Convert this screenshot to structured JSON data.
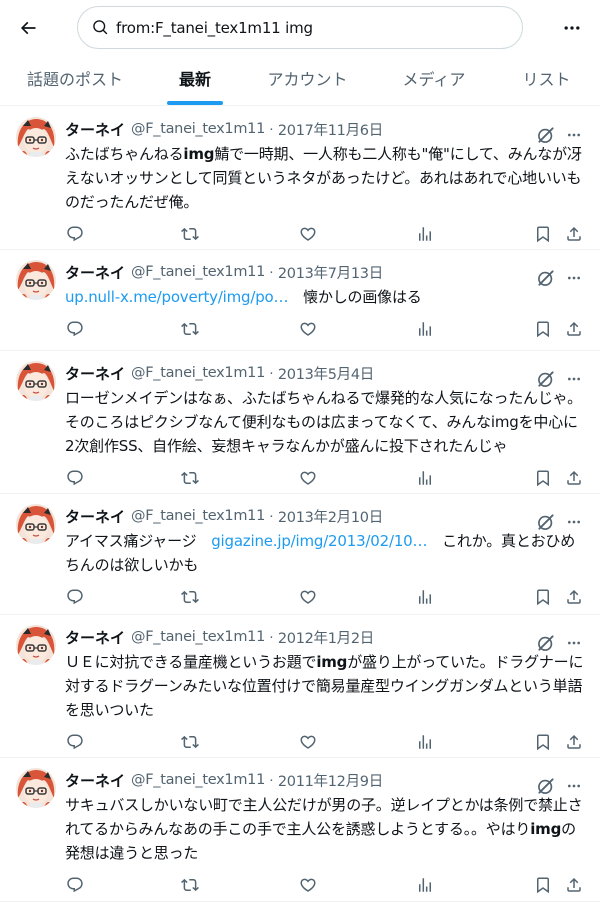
{
  "search": {
    "query": "from:F_tanei_tex1m11 img"
  },
  "tabs": [
    {
      "label": "話題のポスト",
      "active": false
    },
    {
      "label": "最新",
      "active": true
    },
    {
      "label": "アカウント",
      "active": false
    },
    {
      "label": "メディア",
      "active": false
    },
    {
      "label": "リスト",
      "active": false
    }
  ],
  "author": {
    "name": "ターネイ",
    "handle": "@F_tanei_tex1m11"
  },
  "tweets": [
    {
      "date": "2017年11月6日",
      "text_parts": [
        {
          "t": "ふたばちゃんねる"
        },
        {
          "t": "img",
          "bold": true
        },
        {
          "t": "鯖で一時期、一人称も二人称も\"俺\"にして、みんなが冴えないオッサンとして同質というネタがあったけど。あれはあれで心地いいものだったんだぜ俺。"
        }
      ]
    },
    {
      "date": "2013年7月13日",
      "text_parts": [
        {
          "t": "up.null-x.me/poverty/img/po…",
          "link": true
        },
        {
          "t": "　懐かしの画像はる"
        }
      ]
    },
    {
      "date": "2013年5月4日",
      "text_parts": [
        {
          "t": "ローゼンメイデンはなぁ、ふたばちゃんねるで爆発的な人気になったんじゃ。そのころはピクシブなんて便利なものは広まってなくて、みんなimgを中心に2次創作SS、自作絵、妄想キャラなんかが盛んに投下されたんじゃ"
        }
      ]
    },
    {
      "date": "2013年2月10日",
      "text_parts": [
        {
          "t": "アイマス痛ジャージ　"
        },
        {
          "t": "gigazine.jp/img/2013/02/10…",
          "link": true
        },
        {
          "t": "　これか。真とおひめちんのは欲しいかも"
        }
      ]
    },
    {
      "date": "2012年1月2日",
      "text_parts": [
        {
          "t": "ＵＥに対抗できる量産機というお題で"
        },
        {
          "t": "img",
          "bold": true
        },
        {
          "t": "が盛り上がっていた。ドラグナーに対するドラグーンみたいな位置付けで簡易量産型ウイングガンダムという単語を思いついた"
        }
      ]
    },
    {
      "date": "2011年12月9日",
      "text_parts": [
        {
          "t": "サキュバスしかいない町で主人公だけが男の子。逆レイプとかは条例で禁止されてるからみんなあの手この手で主人公を誘惑しようとする。。やはり"
        },
        {
          "t": "img",
          "bold": true
        },
        {
          "t": "の発想は違うと思った"
        }
      ]
    }
  ],
  "icons": {
    "back": "arrow-left-icon",
    "search": "search-icon",
    "more": "more-horizontal-icon",
    "grok": "grok-icon",
    "reply": "reply-icon",
    "retweet": "retweet-icon",
    "like": "heart-icon",
    "views": "views-icon",
    "bookmark": "bookmark-icon",
    "share": "share-icon"
  },
  "colors": {
    "accent": "#1d9bf0",
    "text": "#0f1419",
    "muted": "#536471",
    "border": "#eff3f4"
  }
}
